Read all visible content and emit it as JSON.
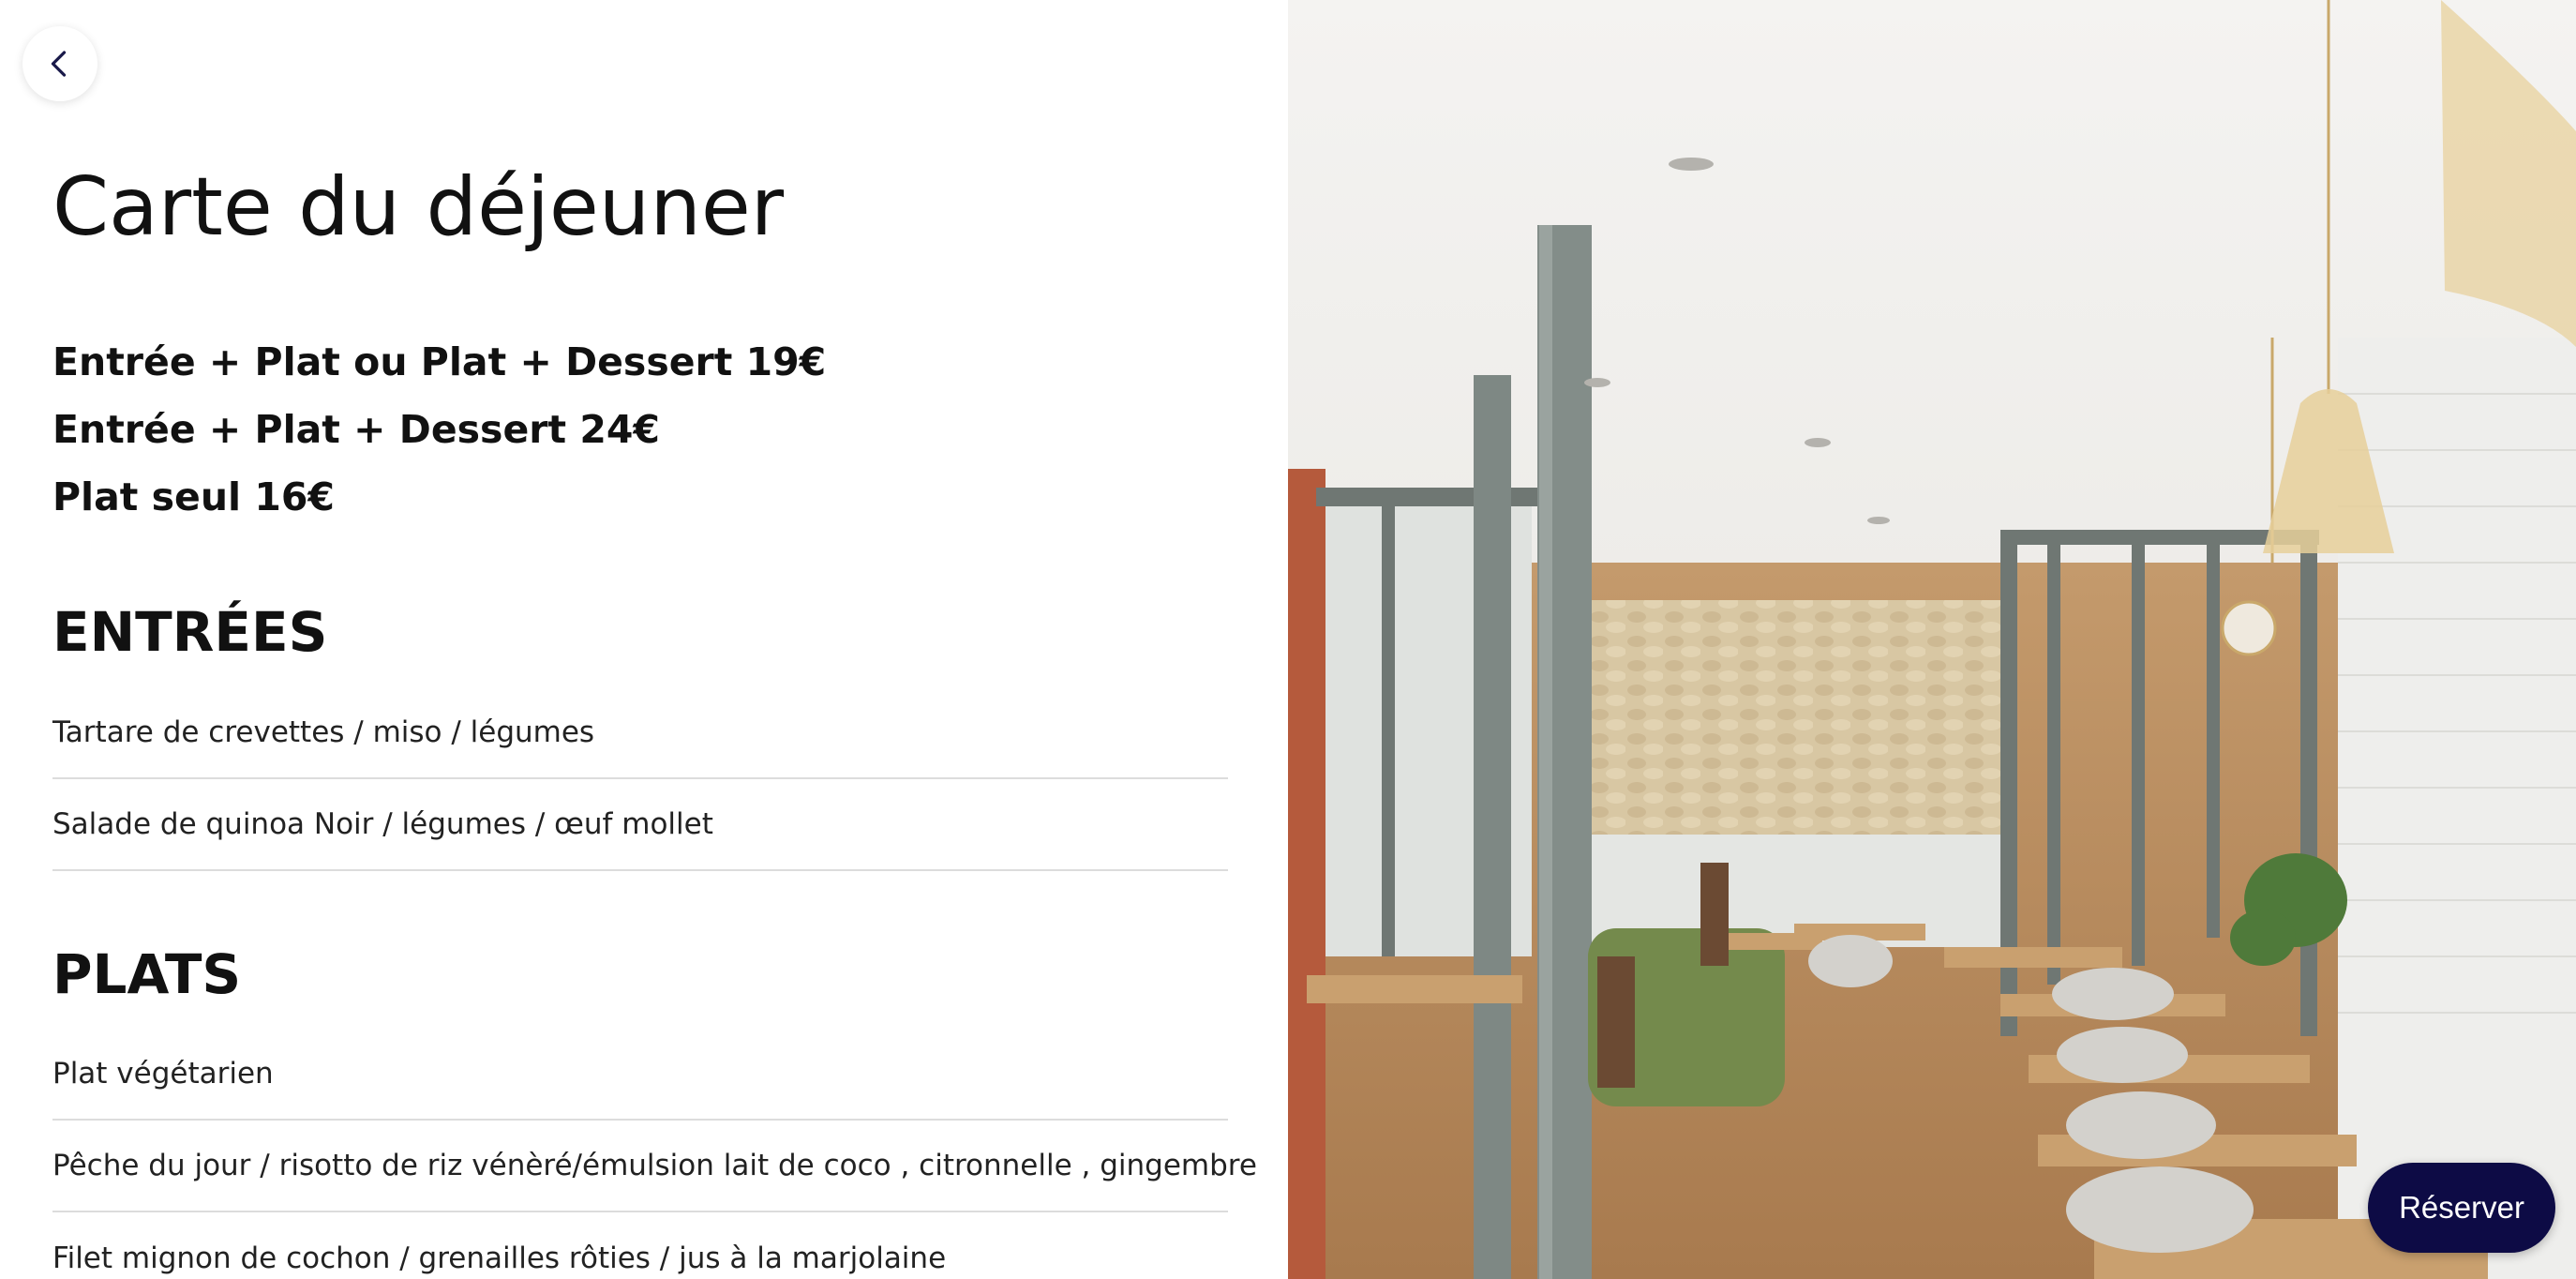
{
  "page": {
    "title": "Carte du déjeuner",
    "formulas": [
      "Entrée + Plat ou Plat + Dessert 19€",
      "Entrée + Plat + Dessert 24€",
      "Plat seul 16€"
    ]
  },
  "sections": {
    "entrees": {
      "title": "ENTRÉES",
      "items": [
        "Tartare de crevettes / miso / légumes",
        "Salade de quinoa Noir / légumes / œuf mollet"
      ]
    },
    "plats": {
      "title": "PLATS",
      "items": [
        "Plat végétarien",
        "Pêche du jour / risotto de riz vénèré/émulsion lait de coco , citronnelle , gingembre",
        "Filet mignon de cochon / grenailles rôties / jus à la marjolaine"
      ]
    }
  },
  "actions": {
    "reserve_label": "Réserver"
  },
  "icons": {
    "back": "chevron-left-icon"
  },
  "colors": {
    "accent": "#0d0b45",
    "divider": "#dcdcdc",
    "text": "#111111"
  }
}
